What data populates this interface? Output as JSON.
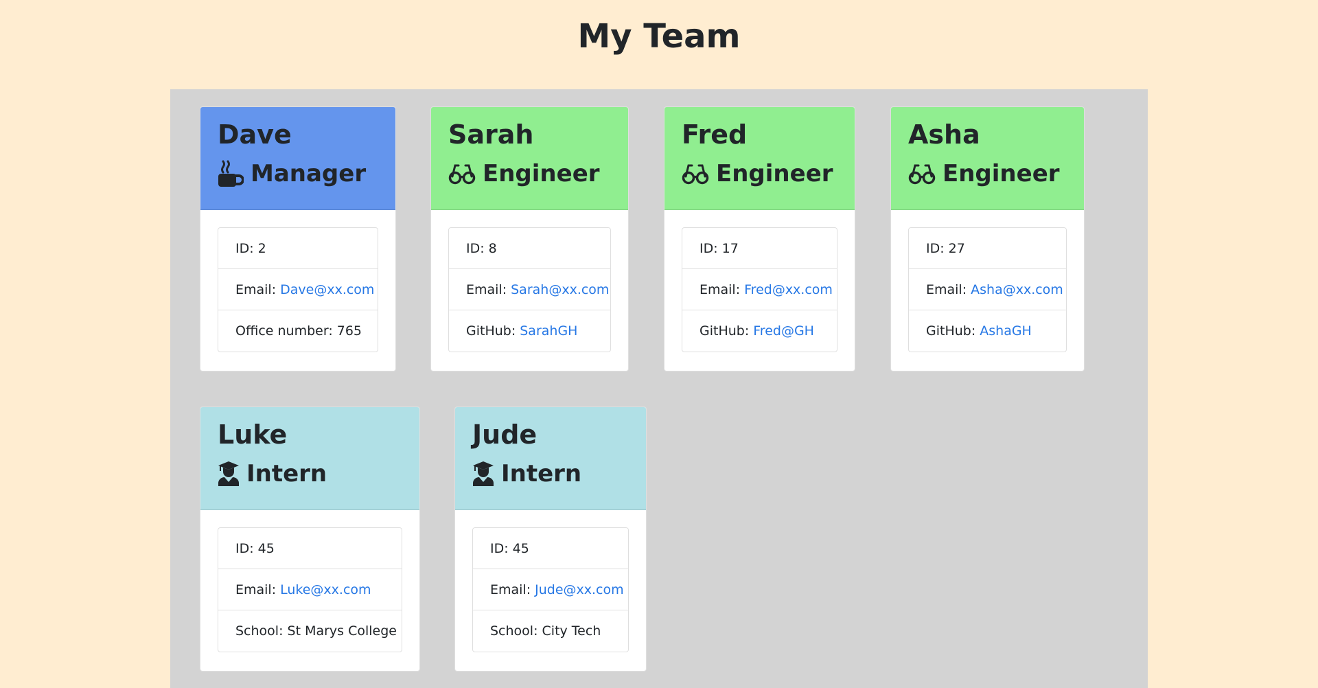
{
  "page_title": "My Team",
  "team": [
    {
      "name": "Dave",
      "role": "Manager",
      "role_icon": "mug-hot-icon",
      "header_color": "#6495ed",
      "id_text": "ID: 2",
      "email_label": "Email:",
      "email": "Dave@xx.com",
      "extra_label": "Office number: 765",
      "extra_link": ""
    },
    {
      "name": "Sarah",
      "role": "Engineer",
      "role_icon": "glasses-icon",
      "header_color": "#90ee90",
      "id_text": "ID: 8",
      "email_label": "Email:",
      "email": "Sarah@xx.com",
      "extra_label": "GitHub:",
      "extra_link": "SarahGH"
    },
    {
      "name": "Fred",
      "role": "Engineer",
      "role_icon": "glasses-icon",
      "header_color": "#90ee90",
      "id_text": "ID: 17",
      "email_label": "Email:",
      "email": "Fred@xx.com",
      "extra_label": "GitHub:",
      "extra_link": "Fred@GH"
    },
    {
      "name": "Asha",
      "role": "Engineer",
      "role_icon": "glasses-icon",
      "header_color": "#90ee90",
      "id_text": "ID: 27",
      "email_label": "Email:",
      "email": "Asha@xx.com",
      "extra_label": "GitHub:",
      "extra_link": "AshaGH"
    },
    {
      "name": "Luke",
      "role": "Intern",
      "role_icon": "graduate-icon",
      "header_color": "#b0e0e6",
      "id_text": "ID: 45",
      "email_label": "Email:",
      "email": "Luke@xx.com",
      "extra_label": "School: St Marys College",
      "extra_link": ""
    },
    {
      "name": "Jude",
      "role": "Intern",
      "role_icon": "graduate-icon",
      "header_color": "#b0e0e6",
      "id_text": "ID: 45",
      "email_label": "Email:",
      "email": "Jude@xx.com",
      "extra_label": "School: City Tech",
      "extra_link": ""
    }
  ],
  "colors": {
    "page_background": "#ffedd1",
    "team_area_background": "#d3d3d3",
    "link": "#2778e5"
  }
}
